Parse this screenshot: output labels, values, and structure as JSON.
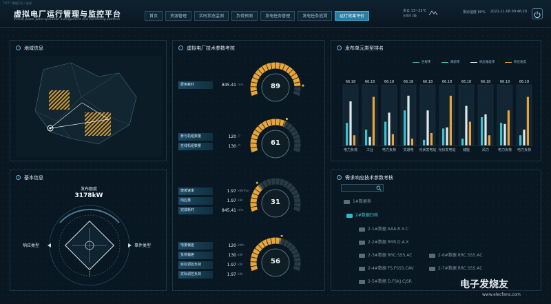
{
  "header": {
    "topline": "TPCT / 数据平台 / 监测",
    "title": "虚拟电厂运行管理与监控平台",
    "subtitle": "Virtual power plant operation management and monitoring platform",
    "tabs": [
      "首页",
      "资源管理",
      "实时状态监测",
      "负荷预测",
      "发电任务管理",
      "发电任务追溯",
      "运行效果评价"
    ],
    "active_tab": 6,
    "weather": "多云 13~22℃",
    "weather_sub": "东南风 2级",
    "humidity": "相对湿度 60%",
    "datetime": "2021-11-08 09:46:20"
  },
  "geo_panel": {
    "title": "地域信息"
  },
  "basic_panel": {
    "title": "基本信息",
    "capacity_label": "发布额度",
    "capacity_value": "3178kW",
    "left_label": "响应类型",
    "right_label": "事件类型"
  },
  "tech_panel": {
    "title": "虚拟电厂技术参数考核",
    "gauges": [
      {
        "value": 89,
        "level": 0.89,
        "rows": [
          {
            "label": "费用耗时",
            "value": "845.41",
            "unit": "min"
          }
        ]
      },
      {
        "value": 61,
        "level": 0.61,
        "rows": [
          {
            "label": "参与机组数量",
            "value": "120",
            "unit": "户"
          },
          {
            "label": "在线机组数量",
            "value": "130",
            "unit": "户"
          }
        ]
      },
      {
        "value": 31,
        "level": 0.31,
        "rows": [
          {
            "label": "爬坡速率",
            "value": "1.97",
            "unit": "kW/min"
          },
          {
            "label": "响应量",
            "value": "1.97",
            "unit": "kW"
          },
          {
            "label": "完成耗时",
            "value": "845.41",
            "unit": "min"
          }
        ]
      },
      {
        "value": 56,
        "level": 0.56,
        "rows": [
          {
            "label": "电量偏差",
            "value": "120",
            "unit": "kWh"
          },
          {
            "label": "负荷偏差",
            "value": "130",
            "unit": "kW"
          },
          {
            "label": "目标调控负荷",
            "value": "1.97",
            "unit": "kW"
          },
          {
            "label": "实际调控负荷",
            "value": "1.97",
            "unit": "kW"
          }
        ]
      }
    ]
  },
  "ranking_panel": {
    "title": "发布单元类型排名",
    "legend": [
      {
        "name": "合规率",
        "color": "#3fc1d0"
      },
      {
        "name": "跟踪率",
        "color": "#4fd0e0"
      },
      {
        "name": "响应偏差率",
        "color": "#ffffff"
      },
      {
        "name": "响应速度",
        "color": "#e8a33a"
      }
    ]
  },
  "chart_data": {
    "type": "bar",
    "title": "发布单元类型排名",
    "categories": [
      "电力负荷",
      "工业",
      "电力负荷",
      "交通电",
      "光伏发电站",
      "光伏发电站",
      "储能",
      "风力",
      "电力负荷",
      "电力负荷"
    ],
    "top_labels": [
      "66.18",
      "66.18",
      "66.18",
      "66.18",
      "66.18",
      "66.18",
      "66.18",
      "66.18",
      "66.18",
      "66.18"
    ],
    "series": [
      {
        "name": "合规率",
        "color": "#3fc1d0",
        "values": [
          40,
          28,
          42,
          62,
          10,
          30,
          12,
          50,
          40,
          18
        ]
      },
      {
        "name": "跟踪率",
        "color": "#dfe8ec",
        "values": [
          78,
          15,
          58,
          88,
          62,
          32,
          70,
          55,
          38,
          28
        ]
      },
      {
        "name": "响应速度",
        "color": "#e8a33a",
        "values": [
          18,
          86,
          20,
          12,
          22,
          88,
          42,
          18,
          62,
          86
        ]
      }
    ],
    "ylim": [
      0,
      100
    ]
  },
  "demand_panel": {
    "title": "需求响应技术参数考核",
    "tree": [
      {
        "label": "1#数据表",
        "active": false
      },
      {
        "label": "2#数据归档",
        "active": true
      },
      {
        "label": "2-1#数据 AAA.R.X.C",
        "active": false
      },
      {
        "label": "2-2#数据 RRR.D.A.X",
        "active": false
      },
      {
        "label": "2-3#数据 RRC.SSS.AC",
        "active": false
      },
      {
        "label": "2-6#数据 RRC.SSS.AC",
        "active": false
      },
      {
        "label": "2-4#数据 FS.FSSS.CAV",
        "active": false
      },
      {
        "label": "2-7#数据 RRC.SSS.AC",
        "active": false
      },
      {
        "label": "2-5#数据 D.FSKJ.CJSR",
        "active": false
      }
    ]
  },
  "watermark": {
    "text": "电子发烧友",
    "sub": "www.elecfans.com"
  }
}
